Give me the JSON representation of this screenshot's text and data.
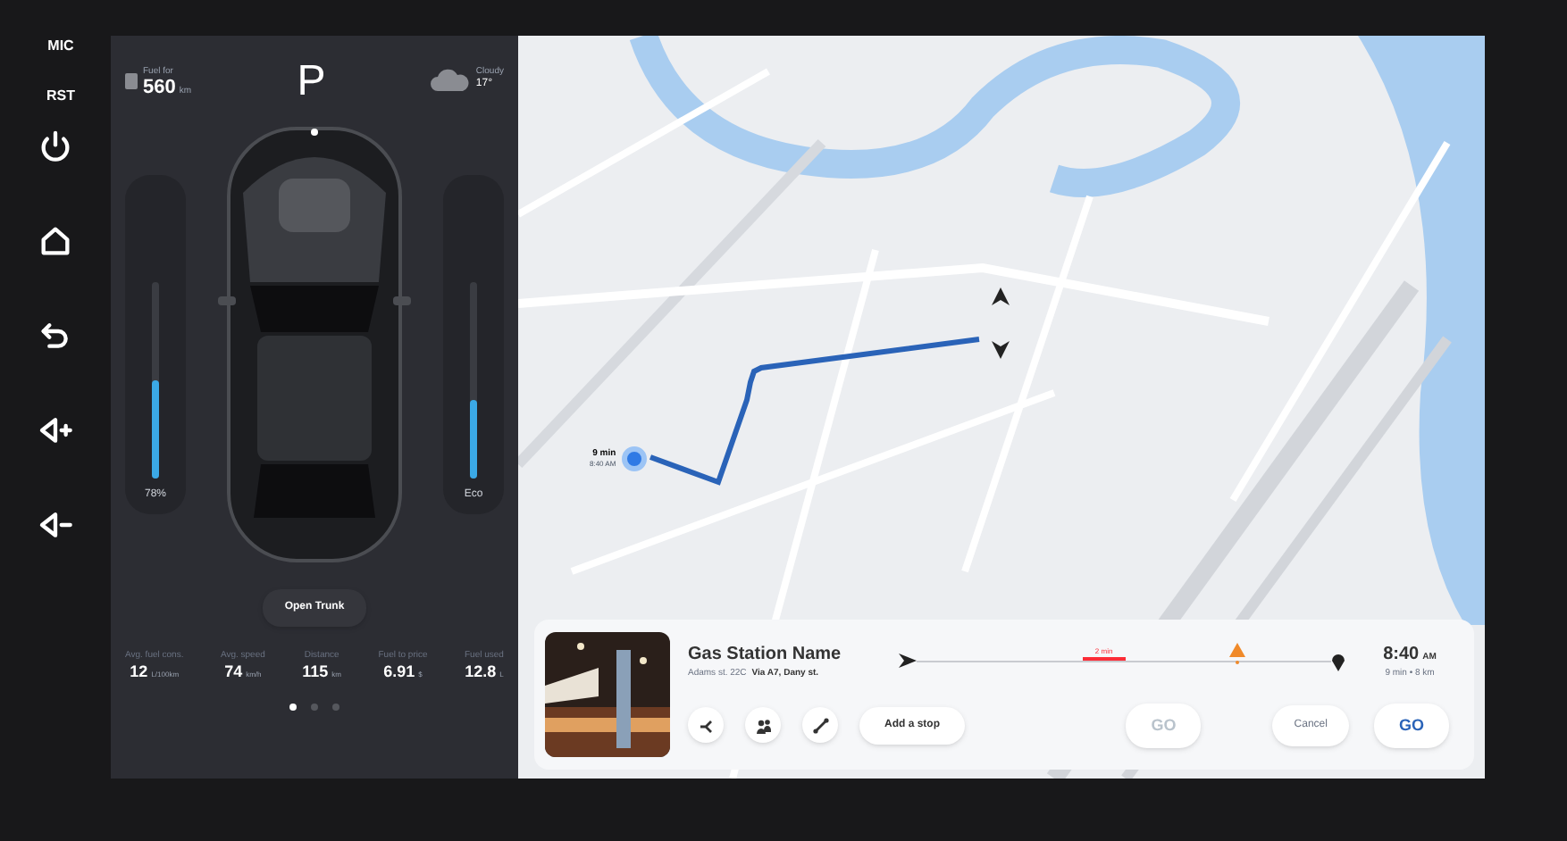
{
  "hardware_labels": [
    "MIC",
    "RST"
  ],
  "header": {
    "range_label": "Fuel for",
    "range_value": "560",
    "range_unit": "km",
    "gear": "P",
    "weather_label": "Cloudy",
    "temperature": "17°"
  },
  "sliders": [
    {
      "reading": "78%",
      "level": 0.5
    },
    {
      "reading": "Eco",
      "level": 0.4
    }
  ],
  "trunk_button": "Open Trunk",
  "stats": [
    {
      "label": "Avg. fuel cons.",
      "value": "12",
      "unit": "L/100km"
    },
    {
      "label": "Avg. speed",
      "value": "74",
      "unit": "km/h"
    },
    {
      "label": "Distance",
      "value": "115",
      "unit": "km"
    },
    {
      "label": "Fuel to price",
      "value": "6.91",
      "unit": "$"
    },
    {
      "label": "Fuel used",
      "value": "12.8",
      "unit": "L"
    }
  ],
  "pages": [
    {
      "selected": true
    },
    {
      "selected": false
    },
    {
      "selected": false
    }
  ],
  "map": {
    "eta_bubble": {
      "duration": "9 min",
      "time": "8:40 AM"
    }
  },
  "destination": {
    "name": "Gas Station Name",
    "address": "Adams st. 22C",
    "via": "Via A7, Dany st.",
    "delay": "2 min",
    "arrival": "8:40",
    "meridiem": "AM",
    "summary": "9 min • 8 km",
    "add_stop": "Add a stop",
    "actions": [
      {
        "label": "GO",
        "kind": "go",
        "disabled": true
      },
      {
        "label": "Cancel",
        "kind": "plain",
        "disabled": false
      },
      {
        "label": "GO",
        "kind": "go",
        "disabled": false
      }
    ]
  }
}
